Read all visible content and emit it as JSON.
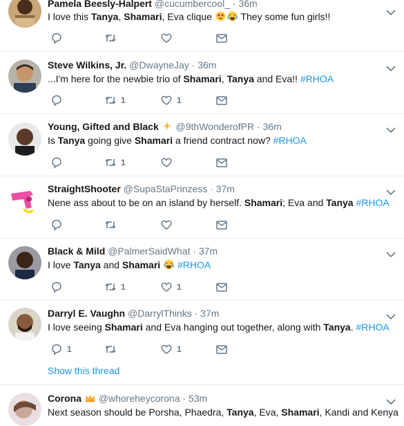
{
  "tweets": [
    {
      "name": "Pamela Beesly-Halpert",
      "handle": "@cucumbercool_",
      "time": "36m",
      "parts": [
        "I love this ",
        "Tanya",
        ", ",
        "Shamari",
        ", Eva clique ",
        " They some fun girls!!"
      ],
      "reply_count": "",
      "retweet_count": "",
      "like_count": ""
    },
    {
      "name": "Steve Wilkins, Jr.",
      "handle": "@DwayneJay",
      "time": "36m",
      "parts": [
        "...I'm here for the newbie trio of ",
        "Shamari",
        ", ",
        "Tanya",
        " and Eva!! ",
        "#RHOA"
      ],
      "reply_count": "",
      "retweet_count": "1",
      "like_count": "1"
    },
    {
      "name": "Young, Gifted and Black",
      "handle": "@9thWonderofPR",
      "time": "36m",
      "parts": [
        "Is ",
        "Tanya",
        " going give ",
        "Shamari",
        " a friend contract now? ",
        "#RHOA"
      ],
      "reply_count": "",
      "retweet_count": "1",
      "like_count": ""
    },
    {
      "name": "StraightShooter",
      "handle": "@SupaStaPrinzess",
      "time": "37m",
      "parts": [
        "Nene ass about to be on an island by herself. ",
        "Shamari",
        "; Eva and ",
        "Tanya",
        "  ",
        "#RHOA"
      ],
      "reply_count": "",
      "retweet_count": "",
      "like_count": ""
    },
    {
      "name": "Black & Mild",
      "handle": "@PalmerSaidWhat",
      "time": "37m",
      "parts": [
        "I love ",
        "Tanya",
        " and ",
        "Shamari",
        " ",
        "#RHOA"
      ],
      "reply_count": "",
      "retweet_count": "1",
      "like_count": "1"
    },
    {
      "name": "Darryl E. Vaughn",
      "handle": "@DarrylThinks",
      "time": "37m",
      "parts": [
        "I love seeing ",
        "Shamari",
        " and Eva hanging out together, along with ",
        "Tanya",
        ". ",
        "#RHOA"
      ],
      "reply_count": "1",
      "retweet_count": "",
      "like_count": "1",
      "show_thread": "Show this thread"
    },
    {
      "name": "Corona",
      "handle": "@whoreheycorona",
      "time": "53m",
      "parts": [
        "Next season should be Porsha, Phaedra, ",
        "Tanya",
        ", Eva, ",
        "Shamari",
        ", Kandi and Kenya"
      ]
    }
  ],
  "icons": {
    "reply": "reply-icon",
    "retweet": "retweet-icon",
    "like": "heart-icon",
    "dm": "envelope-icon",
    "caret": "chevron-down-icon"
  },
  "colors": {
    "link": "#1b95e0",
    "muted": "#657786",
    "text": "#14171a",
    "divider": "#e6ecf0"
  }
}
